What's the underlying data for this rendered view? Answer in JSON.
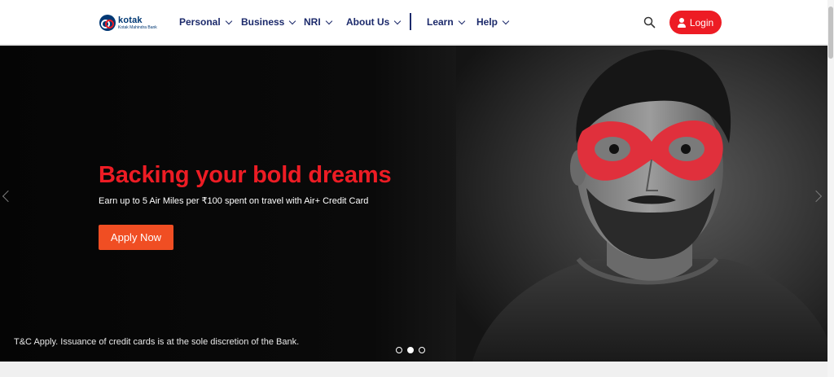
{
  "header": {
    "logo": {
      "word": "kotak",
      "sub": "Kotak Mahindra Bank"
    },
    "nav": [
      {
        "label": "Personal"
      },
      {
        "label": "Business"
      },
      {
        "label": "NRI"
      },
      {
        "label": "About Us"
      },
      {
        "label": "Learn"
      },
      {
        "label": "Help"
      }
    ],
    "search_icon": "search-icon",
    "login_label": "Login"
  },
  "hero": {
    "title": "Backing your bold dreams",
    "subtitle": "Earn up to 5 Air Miles per ₹100 spent on travel with Air+ Credit Card",
    "cta": "Apply Now",
    "disclaimer": "T&C Apply. Issuance of credit cards is at the sole discretion of the Bank.",
    "slides_total": 3,
    "slide_active": 2
  },
  "colors": {
    "brand_red": "#ed1c24",
    "cta_orange": "#f04e23",
    "nav_navy": "#1c2a6b",
    "logo_blue": "#003874"
  }
}
